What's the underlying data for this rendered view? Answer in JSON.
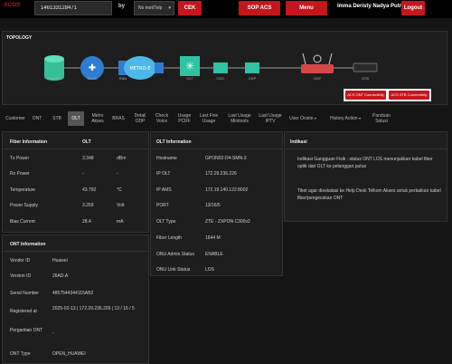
{
  "header": {
    "brand": "ACSIS",
    "search_value": "146133128471",
    "by_label": "by",
    "by_select": "No inet/Telp",
    "cek_label": "CEK",
    "sop_label": "SOP ACS",
    "menu_label": "Menu",
    "user_name": "Imma Deristy Nadya Putri",
    "logout_label": "Logout"
  },
  "topology": {
    "title": "TOPOLOGY",
    "nodes": [
      "RADIUS",
      "BRAS",
      "RAN",
      "METRO-E",
      "OLT",
      "ODC",
      "ODP",
      "ONT",
      "STB"
    ],
    "acs_ont_label": "ACS ONT Connectivity",
    "acs_stb_label": "ACS STB Connectivity"
  },
  "tabs": [
    {
      "label": "Customer"
    },
    {
      "label": "ONT"
    },
    {
      "label": "STB"
    },
    {
      "label": "OLT"
    },
    {
      "label": "Metro Akses"
    },
    {
      "label": "BRAS"
    },
    {
      "label": "Detail ODP"
    },
    {
      "label": "Check Voice"
    },
    {
      "label": "Usage PCRF"
    },
    {
      "label": "Last Five Usage"
    },
    {
      "label": "Last Usage Minitools"
    },
    {
      "label": "Last Usage IPTV"
    },
    {
      "label": "User Onsite"
    },
    {
      "label": "History Action"
    },
    {
      "label": "Panduan Solusi"
    }
  ],
  "fiber": {
    "title": "Fiber Information",
    "col_olt": "OLT",
    "rows": [
      {
        "label": "Tx Power",
        "value": "3.348",
        "unit": "dBm"
      },
      {
        "label": "Rx Power",
        "value": "-",
        "unit": "-"
      },
      {
        "label": "Temperature",
        "value": "43.792",
        "unit": "°C"
      },
      {
        "label": "Power Supply",
        "value": "3.269",
        "unit": "Volt"
      },
      {
        "label": "Bias Current",
        "value": "28.4",
        "unit": "mA"
      }
    ]
  },
  "ont_info": {
    "title": "ONT Information",
    "rows": [
      {
        "label": "Vendor ID",
        "value": "Huawei"
      },
      {
        "label": "Version ID",
        "value": "26AD.A"
      },
      {
        "label": "Serial Number",
        "value": "4857544344115AB2"
      },
      {
        "label": "Registered at",
        "value": "2025-02-13 | 172.29.236.226 | 13 / 16 / 5"
      },
      {
        "label": "Pergantian ONT",
        "value": "-"
      },
      {
        "label": "ONT Type",
        "value": "OPEN_HUAWEI"
      }
    ]
  },
  "olt_info": {
    "title": "OLT Information",
    "rows": [
      {
        "label": "Hostname",
        "value": "GPON02-D4-SMN-3"
      },
      {
        "label": "IP OLT",
        "value": "172.29.236.226"
      },
      {
        "label": "IP AMS",
        "value": "172.19.140.122:8002"
      },
      {
        "label": "PORT",
        "value": "13/16/5"
      },
      {
        "label": "OLT Type",
        "value": "ZTE - ZXPON C300v2"
      },
      {
        "label": "Fiber Length",
        "value": "1644 M"
      },
      {
        "label": "ONU Admin Status",
        "value": "ENABLE"
      },
      {
        "label": "ONU Link Status",
        "value": "LOS"
      }
    ]
  },
  "indikasi": {
    "title": "Indikasi",
    "text1": "Indikasi Gangguan Fisik : status ONT LOS menunjukkan kabel fiber optik dari OLT ke pelanggan putus",
    "text2": "Tiket agar dieskalasi ke Help Desk Telkom Akses untuk perbaikan kabel fiber/pengecekan ONT"
  },
  "colors": {
    "accent": "#c4161c",
    "bg": "#151515",
    "panel": "#1e1e1e"
  }
}
